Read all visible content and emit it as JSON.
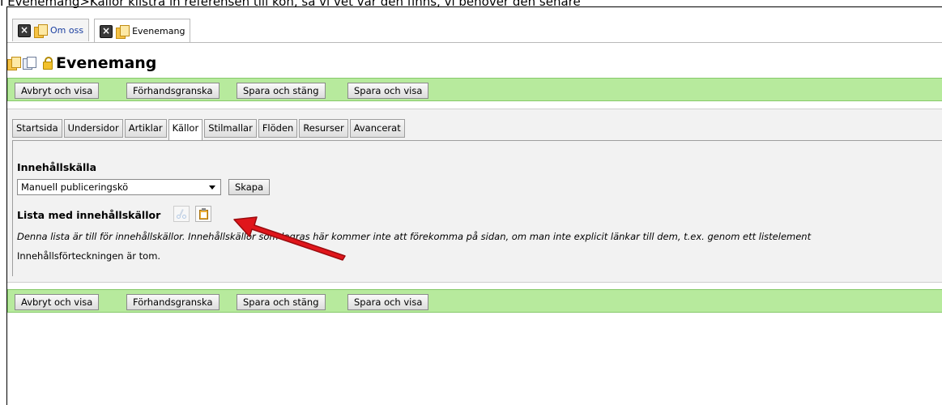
{
  "caption": "I Evenemang>Källor klistra in referensen till kön, så vi vet var den finns, vi behöver den senare",
  "doc_tabs": [
    {
      "label": "Om oss",
      "active": false
    },
    {
      "label": "Evenemang",
      "active": true
    }
  ],
  "page_title": "Evenemang",
  "toolbar": {
    "cancel_label": "Avbryt och visa",
    "preview_label": "Förhandsgranska",
    "save_close_label": "Spara och stäng",
    "save_view_label": "Spara och visa"
  },
  "tabs": [
    "Startsida",
    "Undersidor",
    "Artiklar",
    "Källor",
    "Stilmallar",
    "Flöden",
    "Resurser",
    "Avancerat"
  ],
  "active_tab": "Källor",
  "content_source": {
    "label": "Innehållskälla",
    "selected": "Manuell publiceringskö",
    "create_label": "Skapa"
  },
  "source_list": {
    "label": "Lista med innehållskällor",
    "tools": [
      "scissors-icon",
      "paste-icon"
    ],
    "note": "Denna lista är till för innehållskällor. Innehållskällor som lagras här kommer inte att förekomma på sidan, om man inte explicit länkar till dem, t.ex. genom ett listelement",
    "empty_text": "Innehållsförteckningen är tom."
  },
  "colors": {
    "toolbar_green": "#b7ea9d",
    "panel_gray": "#f2f2f2",
    "arrow_red": "#e0161b",
    "link_blue": "#1a3ea0"
  }
}
